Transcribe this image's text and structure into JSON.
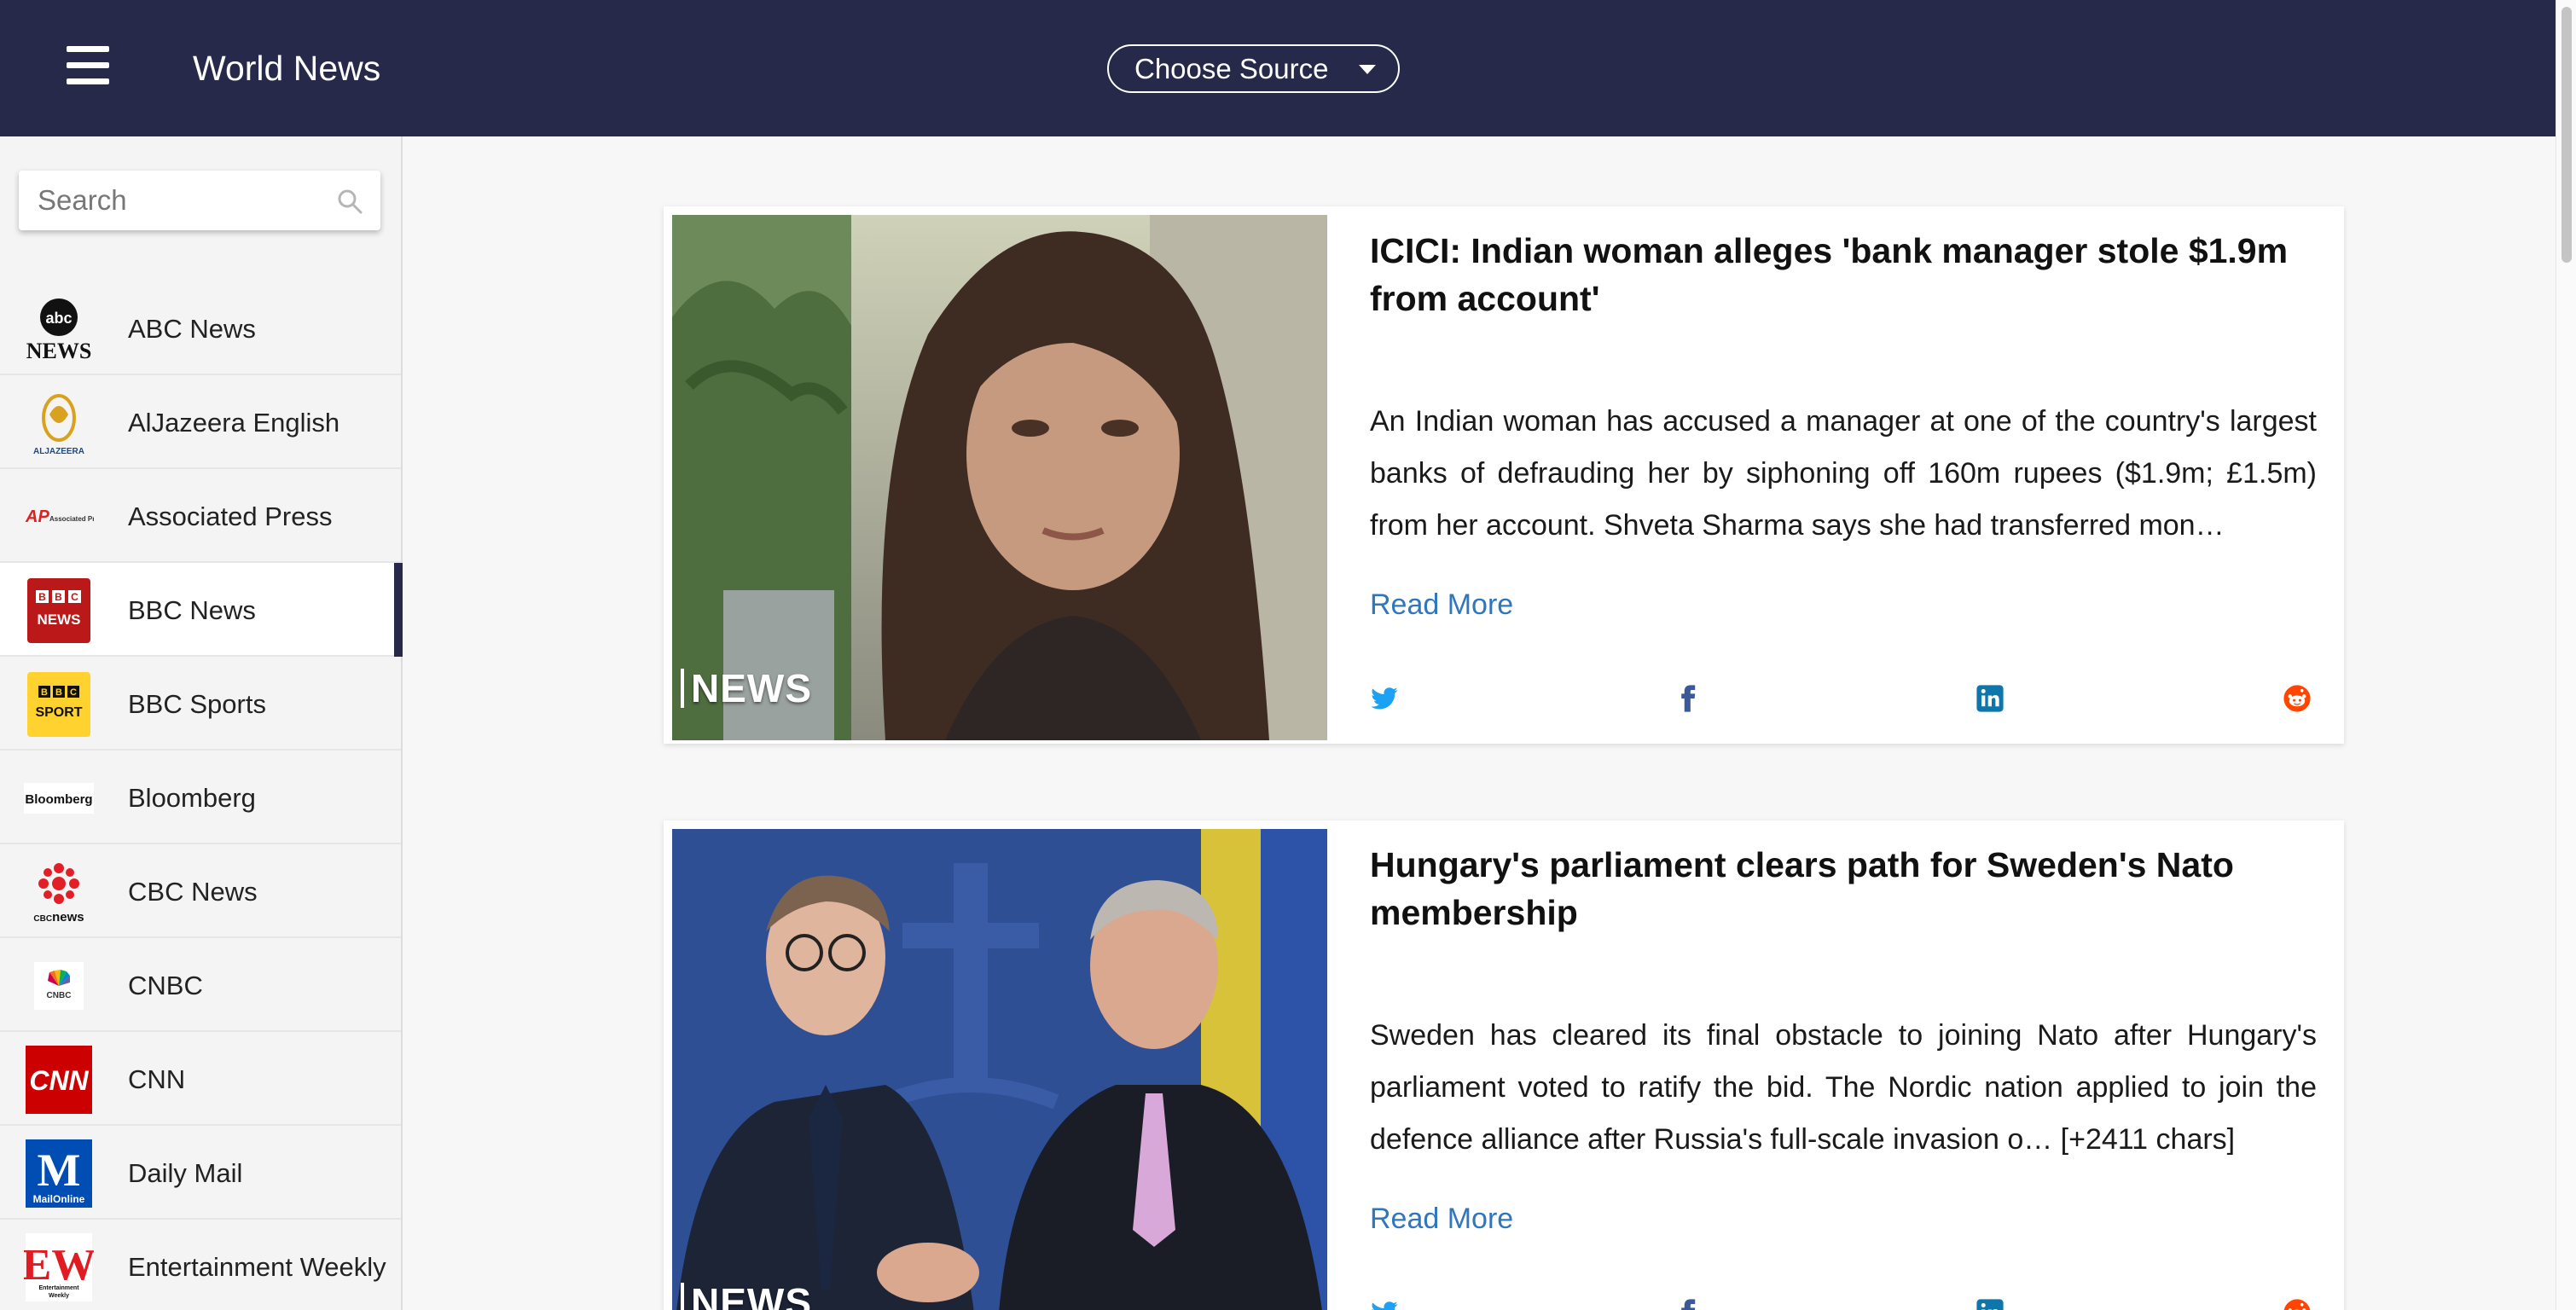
{
  "header": {
    "title": "World News",
    "source_select": "Choose Source"
  },
  "search": {
    "placeholder": "Search"
  },
  "sources": [
    {
      "name": "ABC News",
      "logo_text": "abc NEWS",
      "icon": "abc-news-logo-icon"
    },
    {
      "name": "AlJazeera English",
      "logo_text": "ALJAZEERA",
      "icon": "aljazeera-logo-icon"
    },
    {
      "name": "Associated Press",
      "logo_text": "AP Associated Press",
      "icon": "ap-logo-icon"
    },
    {
      "name": "BBC News",
      "logo_text": "BBC NEWS",
      "icon": "bbc-news-logo-icon",
      "active": true
    },
    {
      "name": "BBC Sports",
      "logo_text": "BBC SPORT",
      "icon": "bbc-sport-logo-icon"
    },
    {
      "name": "Bloomberg",
      "logo_text": "Bloomberg",
      "icon": "bloomberg-logo-icon"
    },
    {
      "name": "CBC News",
      "logo_text": "CBCnews",
      "icon": "cbc-news-logo-icon"
    },
    {
      "name": "CNBC",
      "logo_text": "CNBC",
      "icon": "cnbc-logo-icon"
    },
    {
      "name": "CNN",
      "logo_text": "CNN",
      "icon": "cnn-logo-icon"
    },
    {
      "name": "Daily Mail",
      "logo_text": "Mail Online",
      "icon": "daily-mail-logo-icon"
    },
    {
      "name": "Entertainment Weekly",
      "logo_text": "EW Entertainment Weekly",
      "icon": "ew-logo-icon"
    }
  ],
  "articles": [
    {
      "title": "ICICI: Indian woman alleges 'bank manager stole $1.9m from account'",
      "description": "An Indian woman has accused a manager at one of the country's largest banks of defrauding her by siphoning off 160m rupees ($1.9m; £1.5m) from her account. Shveta Sharma says she had transferred mon…",
      "image_tag": "NEWS",
      "read_more": "Read More"
    },
    {
      "title": "Hungary's parliament clears path for Sweden's Nato membership",
      "description": "Sweden has cleared its final obstacle to joining Nato after Hungary's parliament voted to ratify the bid. The Nordic nation applied to join the defence alliance after Russia's full-scale invasion o… [+2411 chars]",
      "image_tag": "NEWS",
      "read_more": "Read More"
    }
  ],
  "share_icons": [
    "twitter-icon",
    "facebook-icon",
    "linkedin-icon",
    "reddit-icon"
  ],
  "colors": {
    "header_bg": "#262949",
    "link": "#2f77bd",
    "twitter": "#1da1f2",
    "facebook": "#3b5998",
    "linkedin": "#0e76a8",
    "reddit": "#ff4500"
  }
}
